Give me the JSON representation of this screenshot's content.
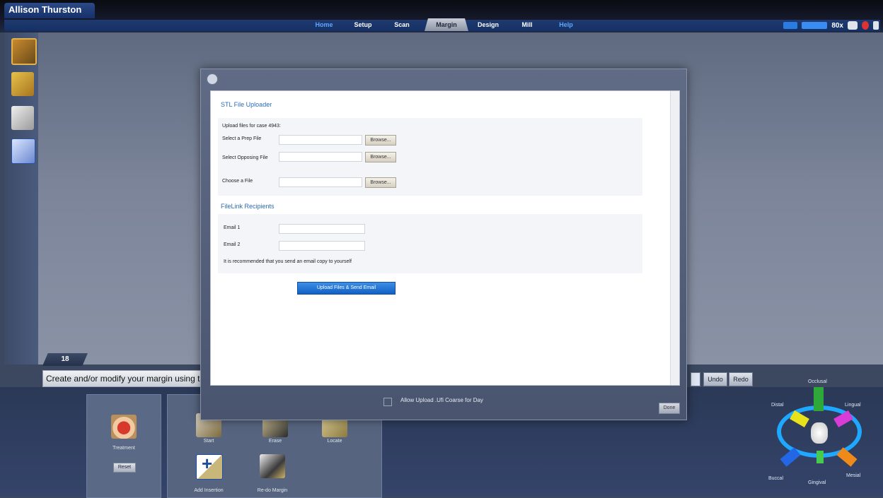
{
  "user": {
    "name": "Allison Thurston"
  },
  "tabs": [
    {
      "label": "Home",
      "state": "dim"
    },
    {
      "label": "Setup",
      "state": "normal"
    },
    {
      "label": "Scan",
      "state": "normal"
    },
    {
      "label": "Margin",
      "state": "active"
    },
    {
      "label": "Design",
      "state": "normal"
    },
    {
      "label": "Mill",
      "state": "normal"
    },
    {
      "label": "Help",
      "state": "dim"
    }
  ],
  "header_right": {
    "zoom": "80x"
  },
  "viewport": {
    "tab_label": "18"
  },
  "status": {
    "text": "Create and/or modify your margin using the"
  },
  "dialog": {
    "uploader_title": "STL File Uploader",
    "intro": "Upload files for case 4943:",
    "rows": [
      {
        "label": "Select a Prep File",
        "button": "Browse..."
      },
      {
        "label": "Select Opposing File",
        "button": "Browse..."
      },
      {
        "label": "Choose a File",
        "button": "Browse..."
      }
    ],
    "recipients_title": "FileLink Recipients",
    "emails": [
      {
        "label": "Email 1"
      },
      {
        "label": "Email 2"
      }
    ],
    "note": "It is recommended that you send an email copy to yourself",
    "upload_button": "Upload Files & Send Email",
    "checkbox_label": "Allow Upload .Ufi Coarse for Day",
    "done_button": "Done"
  },
  "bottom_tools": {
    "panel1": {
      "label": "Treatment",
      "button": "Reset"
    },
    "panel2": [
      {
        "label": "Start"
      },
      {
        "label": "Erase"
      },
      {
        "label": "Locate"
      },
      {
        "label": "Add Insertion"
      },
      {
        "label": "Re-do Margin"
      }
    ]
  },
  "undo_buttons": [
    "Undo",
    "Redo"
  ],
  "navigator": {
    "labels": [
      "Mesial",
      "Distal",
      "Lingual",
      "Buccal",
      "Occlusal",
      "Gingival"
    ]
  },
  "colors": {
    "accent": "#1ea8ff",
    "brand_blue": "#1d4f9b",
    "upload": "#1e6fd1"
  }
}
